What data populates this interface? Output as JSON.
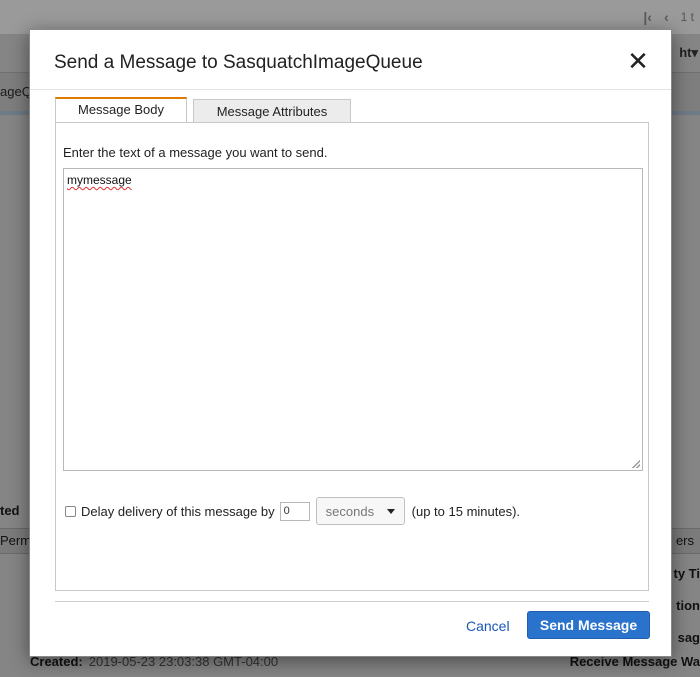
{
  "background": {
    "pager_text": "1 t",
    "sort_label": "ht",
    "queue_label": "ageQ",
    "left_label_1": "ted",
    "left_tab": "Perm",
    "right_tab": "ers",
    "right_labels": [
      "ty Ti",
      "tion",
      "sag"
    ],
    "created_label": "Created:",
    "created_value": "2019-05-23 23:03:38 GMT-04:00",
    "receive_label": "Receive Message Wa"
  },
  "modal": {
    "title": "Send a Message to SasquatchImageQueue",
    "tabs": [
      {
        "label": "Message Body",
        "active": true
      },
      {
        "label": "Message Attributes",
        "active": false
      }
    ],
    "instruction": "Enter the text of a message you want to send.",
    "message_value": "mymessage",
    "delay": {
      "checkbox_label": "Delay delivery of this message by",
      "checked": false,
      "value": "0",
      "unit": "seconds",
      "note": "(up to 15 minutes)."
    },
    "cancel_label": "Cancel",
    "send_label": "Send Message",
    "accent_color": "#e07b00",
    "primary_color": "#2a73cc"
  }
}
